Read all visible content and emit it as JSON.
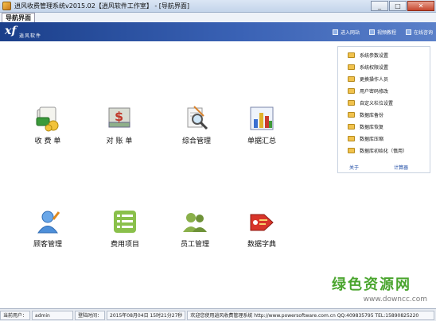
{
  "window": {
    "title": "逍风收费管理系统v2015.02【逍风软件工作室】 - [导航界面]",
    "min": "_",
    "max": "□",
    "close": "✕"
  },
  "tab": {
    "label": "导航界面"
  },
  "banner": {
    "logo": "xf",
    "brand": "逍风软件",
    "links": [
      "进入网站",
      "视频教程",
      "在线咨询"
    ]
  },
  "tiles": [
    {
      "label": "收 费 单",
      "icon": "money-stack-icon"
    },
    {
      "label": "对 账 单",
      "icon": "dollar-ledger-icon"
    },
    {
      "label": "综合管理",
      "icon": "magnifier-doc-icon"
    },
    {
      "label": "单据汇总",
      "icon": "bar-chart-icon"
    },
    {
      "label": "顾客管理",
      "icon": "customer-icon"
    },
    {
      "label": "费用项目",
      "icon": "list-icon"
    },
    {
      "label": "员工管理",
      "icon": "staff-icon"
    },
    {
      "label": "数据字典",
      "icon": "tag-icon"
    }
  ],
  "side": {
    "items": [
      "系统参数设置",
      "系统权限设置",
      "更换操作人员",
      "用户密码修改",
      "自定义栏位设置",
      "数据库备份",
      "数据库恢复",
      "数据库压缩",
      "数据库初始化（慎用）"
    ],
    "about": "关于",
    "calculator": "计算器"
  },
  "watermark": {
    "cn": "绿色资源网",
    "url": "www.downcc.com"
  },
  "status": {
    "user_label": "当前用户：",
    "user_value": "admin",
    "login_label": "登陆时间：",
    "login_value": "2015年08月04日 15时21分27秒",
    "welcome": "欢迎您使用逍风收费管理系统 http://www.powersoftware.com.cn QQ:409835795 TEL:15890825220"
  },
  "colors": {
    "banner": "#1b3f8a",
    "accent_link": "#1947a3",
    "folder": "#f1c24d"
  }
}
